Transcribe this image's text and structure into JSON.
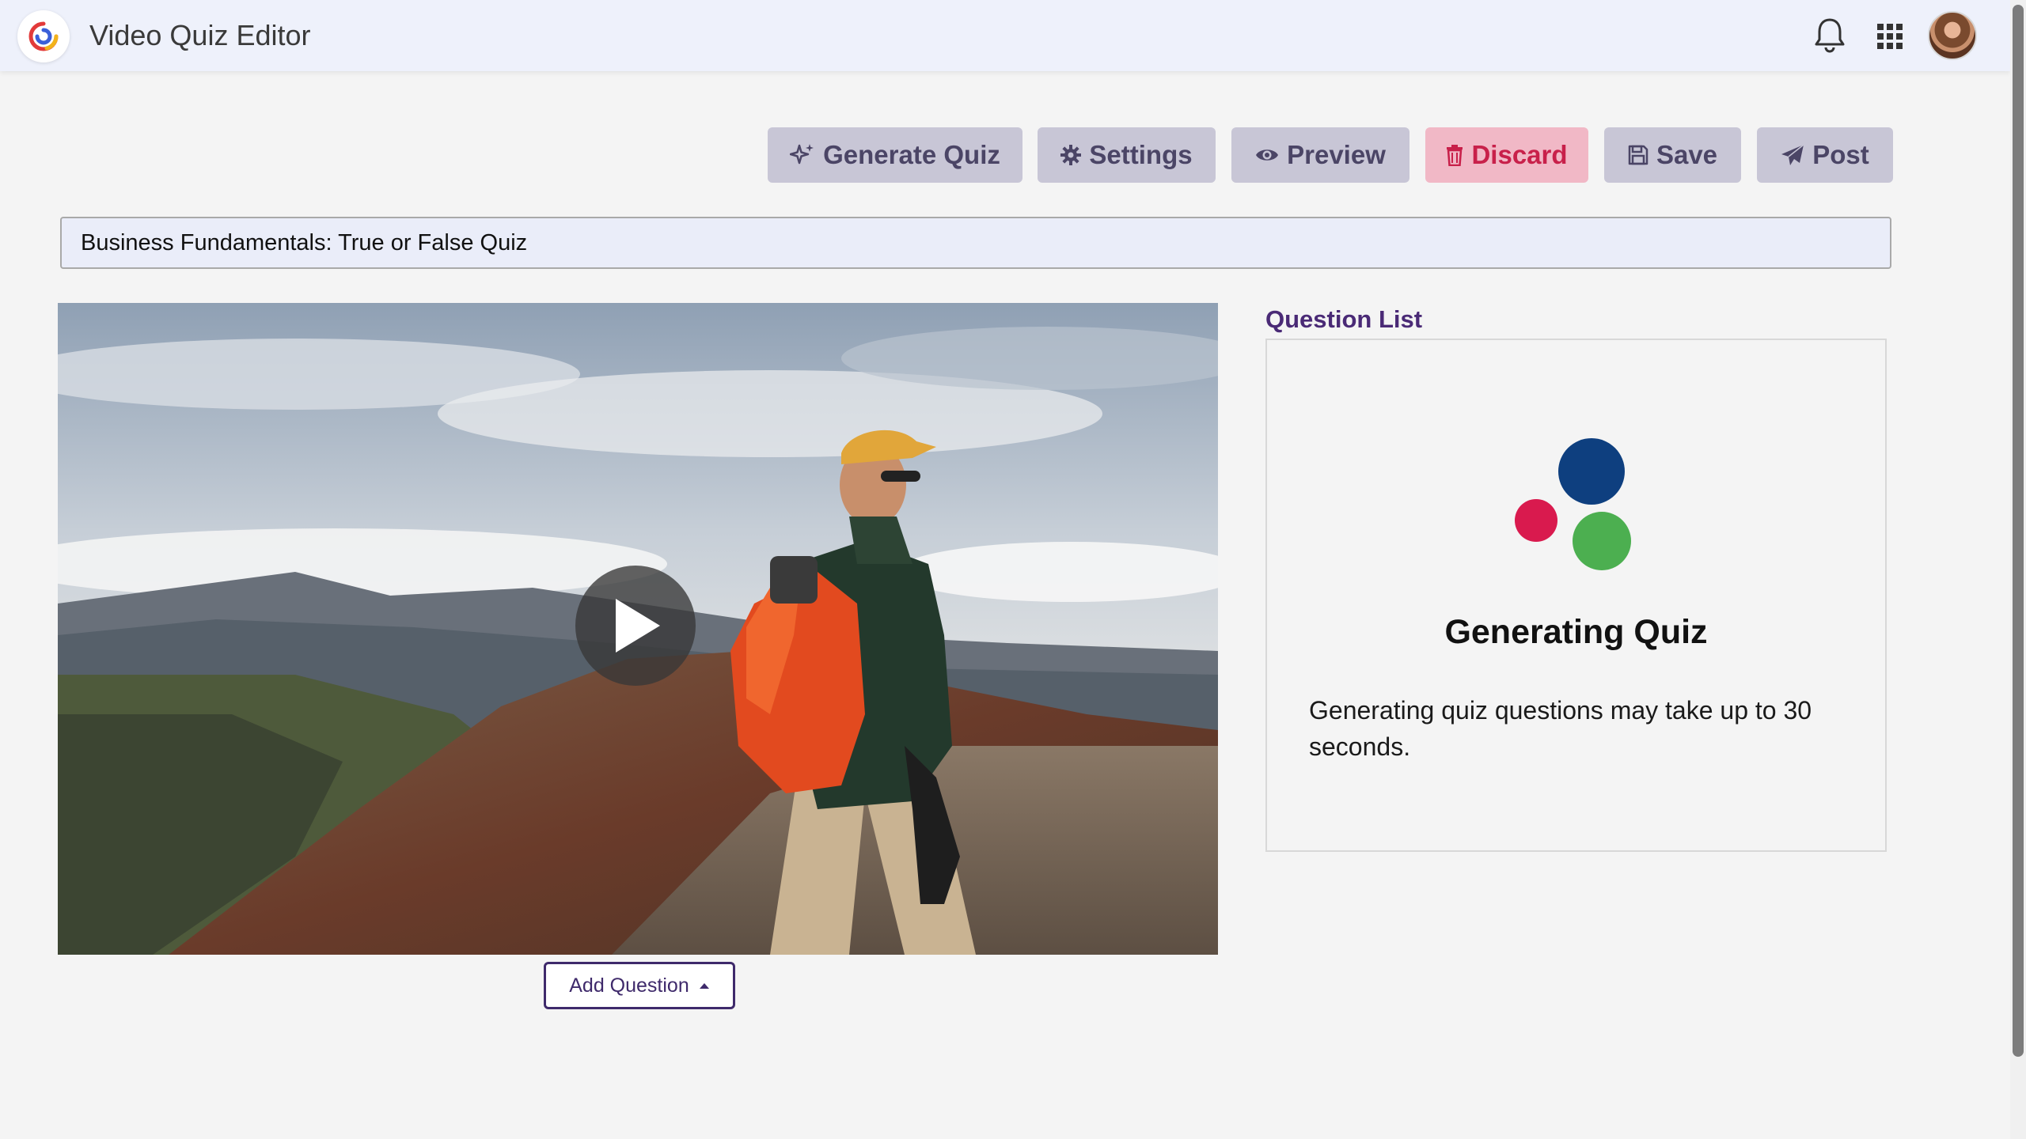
{
  "header": {
    "app_title": "Video Quiz Editor",
    "icons": [
      "app-logo-icon",
      "bell-icon",
      "apps-grid-icon",
      "avatar"
    ]
  },
  "toolbar": {
    "generate_label": "Generate Quiz",
    "settings_label": "Settings",
    "preview_label": "Preview",
    "discard_label": "Discard",
    "save_label": "Save",
    "post_label": "Post"
  },
  "quiz": {
    "title_value": "Business Fundamentals: True or False Quiz"
  },
  "video": {
    "play_icon": "play-icon"
  },
  "add_question": {
    "label": "Add Question"
  },
  "question_list": {
    "heading": "Question List",
    "status_title": "Generating Quiz",
    "status_text": "Generating quiz questions may take up to 30 seconds."
  },
  "colors": {
    "accent": "#4a2a76",
    "button_bg": "#c8c6d6",
    "discard_bg": "#f1b8c6",
    "discard_text": "#c8204a",
    "dot_blue": "#0e3f7f",
    "dot_red": "#d91a4e",
    "dot_green": "#4caf50"
  }
}
